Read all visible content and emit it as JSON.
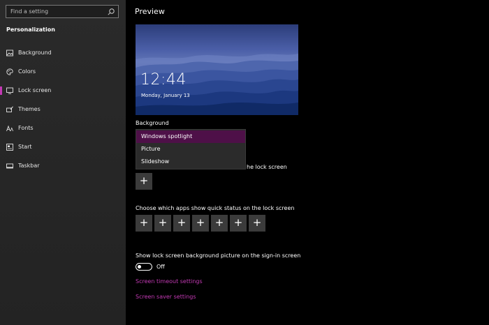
{
  "sidebar": {
    "search_placeholder": "Find a setting",
    "section_title": "Personalization",
    "items": [
      {
        "label": "Background",
        "icon": "image-icon"
      },
      {
        "label": "Colors",
        "icon": "palette-icon"
      },
      {
        "label": "Lock screen",
        "icon": "monitor-icon",
        "active": true
      },
      {
        "label": "Themes",
        "icon": "brush-icon"
      },
      {
        "label": "Fonts",
        "icon": "fonts-icon"
      },
      {
        "label": "Start",
        "icon": "start-icon"
      },
      {
        "label": "Taskbar",
        "icon": "taskbar-icon"
      }
    ]
  },
  "main": {
    "heading": "Preview",
    "preview": {
      "time": "12:44",
      "date": "Monday, January 13"
    },
    "background_label": "Background",
    "dropdown_options": [
      "Windows spotlight",
      "Picture",
      "Slideshow"
    ],
    "dropdown_selected": "Windows spotlight",
    "detailed_status_partial": "he lock screen",
    "quick_status_label": "Choose which apps show quick status on the lock screen",
    "plus_glyph": "+",
    "signin_label": "Show lock screen background picture on the sign-in screen",
    "toggle_state": "Off",
    "links": {
      "timeout": "Screen timeout settings",
      "saver": "Screen saver settings"
    }
  },
  "colors": {
    "accent": "#c239b3",
    "selected_option": "#4e1048"
  }
}
